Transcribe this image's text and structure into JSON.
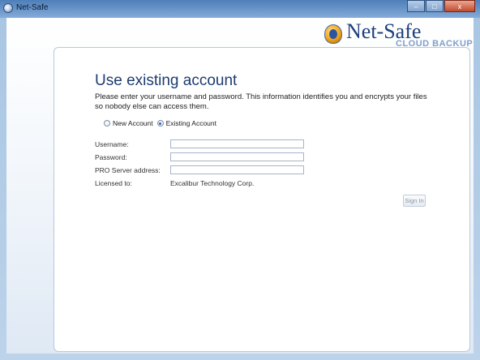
{
  "window": {
    "title": "Net-Safe",
    "controls": {
      "minimize": "–",
      "maximize": "□",
      "close": "x"
    }
  },
  "logo": {
    "text": "Net-Safe",
    "subtitle": "CLOUD BACKUP",
    "icon": "netsafe-badge-icon"
  },
  "main": {
    "heading": "Use existing account",
    "description": "Please enter your username and password. This information identifies you and encrypts your files so nobody else can access them.",
    "radios": [
      {
        "label": "New Account",
        "checked": false
      },
      {
        "label": "Existing Account",
        "checked": true
      }
    ],
    "fields": {
      "username_label": "Username:",
      "username_value": "",
      "password_label": "Password:",
      "password_value": "",
      "server_label": "PRO Server address:",
      "server_value": "",
      "licensed_label": "Licensed to:",
      "licensed_value": "Excalibur Technology Corp."
    },
    "signin_label": "Sign In"
  },
  "colors": {
    "heading": "#1e3c6e",
    "titlebar": "#4f7fb8",
    "frame": "#a9c6e3"
  }
}
